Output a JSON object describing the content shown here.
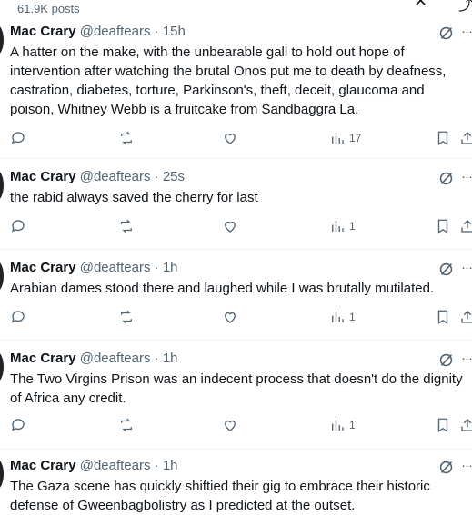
{
  "header": {
    "posts_count": "61.9K posts"
  },
  "colors": {
    "text": "#0f1419",
    "secondary": "#536471",
    "divider": "#eff3f4"
  },
  "tweets": [
    {
      "name": "Mac Crary",
      "handle": "@deaftears · 15h",
      "lines": [
        "A hatter on the make, with the unbearable gall to hold  out hope of",
        "intervention after watching the brutal Onos put me to death by deafness,",
        "castration, diabetes, torture, Parkinson's, theft, deceit, glaucoma and",
        "poison, Whitney Webb is a fruitcake from Sandbaggra La."
      ],
      "views": "17"
    },
    {
      "name": "Mac Crary",
      "handle": "@deaftears · 25s",
      "lines": [
        "the rabid always saved the cherry for last"
      ],
      "views": "1"
    },
    {
      "name": "Mac Crary",
      "handle": "@deaftears · 1h",
      "lines": [
        "Arabian dames stood there and laughed while I was brutally mutilated."
      ],
      "views": "1"
    },
    {
      "name": "Mac Crary",
      "handle": "@deaftears · 1h",
      "lines": [
        "The Two Virgins Prison was an indecent process that doesn't do the dignity",
        "of Africa any credit."
      ],
      "views": "1"
    },
    {
      "name": "Mac Crary",
      "handle": "@deaftears · 1h",
      "lines": [
        "The Gaza scene has quickly shiftied their gig to embrace their historic",
        "defense of Gweenbagbolistry as I predicted at the outset."
      ]
    }
  ]
}
